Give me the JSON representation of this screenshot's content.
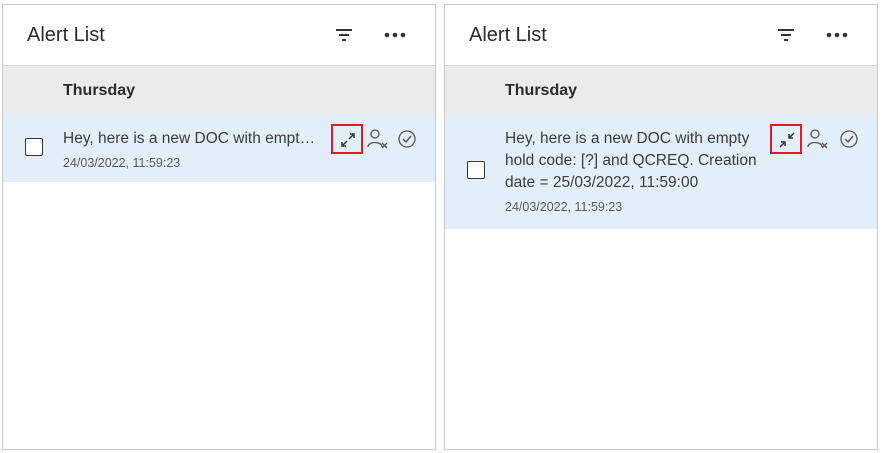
{
  "panels": [
    {
      "title": "Alert List",
      "group_label": "Thursday",
      "alert": {
        "message": "Hey, here is a new DOC with empty hold code: [?] and QCREQ. Creation date = 25/03/2022, 11:59:00",
        "timestamp": "24/03/2022, 11:59:23",
        "state": "collapsed"
      },
      "icons": [
        "filter-icon",
        "more-icon",
        "expand-icon",
        "unassign-user-icon",
        "check-circle-icon"
      ]
    },
    {
      "title": "Alert List",
      "group_label": "Thursday",
      "alert": {
        "message": "Hey, here is a new DOC with empty hold code: [?] and QCREQ. Creation date = 25/03/2022, 11:59:00",
        "timestamp": "24/03/2022, 11:59:23",
        "state": "expanded"
      },
      "icons": [
        "filter-icon",
        "more-icon",
        "collapse-icon",
        "unassign-user-icon",
        "check-circle-icon"
      ]
    }
  ],
  "colors": {
    "row_selected_bg": "#e3eefb",
    "group_bg": "#ebebeb",
    "highlight_border": "#e11b22"
  }
}
